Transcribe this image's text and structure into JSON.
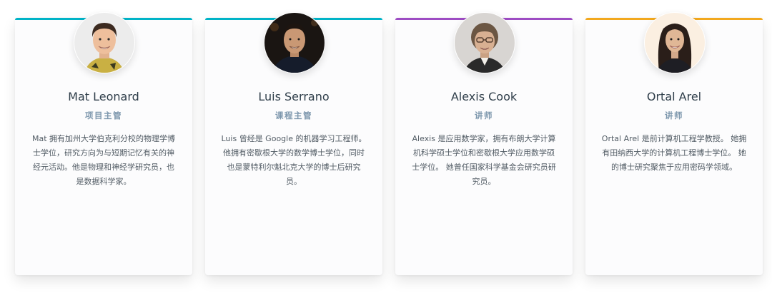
{
  "instructors": [
    {
      "name": "Mat Leonard",
      "role": "项目主管",
      "bio": "Mat 拥有加州大学伯克利分校的物理学博士学位，研究方向为与短期记忆有关的神经元活动。他是物理和神经学研究员，也是数据科学家。",
      "accent": "#00b3c7",
      "avatar_bg": "#eeeeee"
    },
    {
      "name": "Luis Serrano",
      "role": "课程主管",
      "bio": "Luis 曾经是 Google 的机器学习工程师。 他拥有密歇根大学的数学博士学位，同时也是蒙特利尔魁北克大学的博士后研究员。",
      "accent": "#00b3c7",
      "avatar_bg": "#111111"
    },
    {
      "name": "Alexis Cook",
      "role": "讲师",
      "bio": "Alexis 是应用数学家，拥有布朗大学计算机科学硕士学位和密歇根大学应用数学硕士学位。 她曾任国家科学基金会研究员研究员。",
      "accent": "#9d4cc3",
      "avatar_bg": "#d6d3d0"
    },
    {
      "name": "Ortal Arel",
      "role": "讲师",
      "bio": "Ortal Arel 是前计算机工程学教授。 她拥有田纳西大学的计算机工程博士学位。 她的博士研究聚焦于应用密码学领域。",
      "accent": "#f2a81d",
      "avatar_bg": "#fdf0e2"
    }
  ]
}
